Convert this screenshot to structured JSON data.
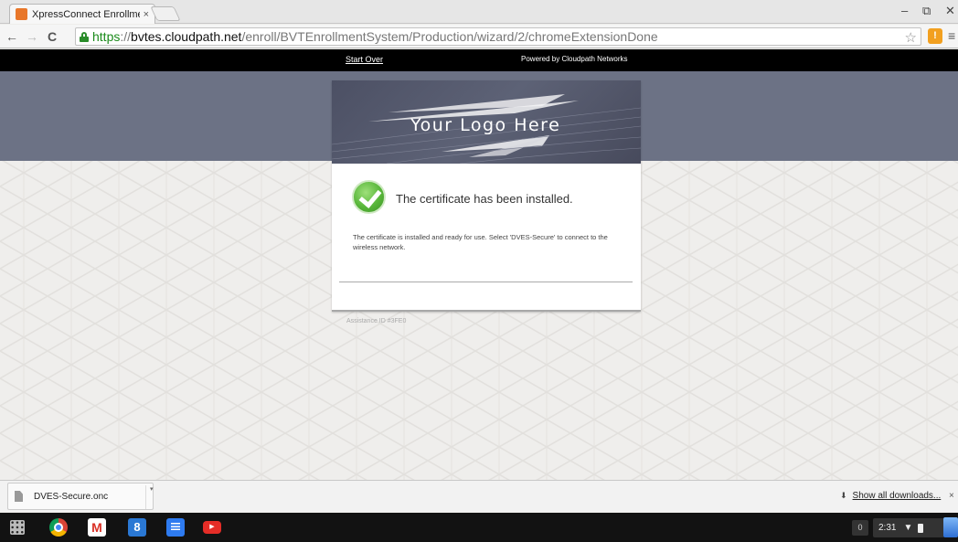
{
  "browser": {
    "tab": {
      "title": "XpressConnect Enrollme",
      "close": "×"
    },
    "window_controls": {
      "minimize": "–",
      "restore": "⧉",
      "close": "✕"
    },
    "nav": {
      "back": "←",
      "forward": "→",
      "reload": "C"
    },
    "url": {
      "scheme": "https",
      "separator": "://",
      "host": "bvtes.cloudpath.net",
      "path": "/enroll/BVTEnrollmentSystem/Production/wizard/2/chromeExtensionDone"
    },
    "star": "☆",
    "extension_label": "!",
    "menu": "≡"
  },
  "page": {
    "topbar": {
      "start_over": "Start Over",
      "powered_by": "Powered by Cloudpath Networks"
    },
    "logo_text": "Your Logo Here",
    "status_heading": "The certificate has been installed.",
    "status_body": "The certificate is installed and ready for use. Select 'DVES-Secure' to connect to the wireless network.",
    "assistance_id": "Assistance ID #3FE0"
  },
  "downloads": {
    "file_name": "DVES-Secure.onc",
    "caret": "▾",
    "show_all": "Show all downloads...",
    "close": "×"
  },
  "os_shelf": {
    "gmail_label": "M",
    "gplus_label": "8",
    "youtube_label": "▶",
    "notification_count": "0",
    "time": "2:31",
    "wifi": "▼"
  },
  "colors": {
    "header_band": "#6c7285",
    "url_scheme": "#1a8a1a",
    "success_green": "#58b63a"
  }
}
